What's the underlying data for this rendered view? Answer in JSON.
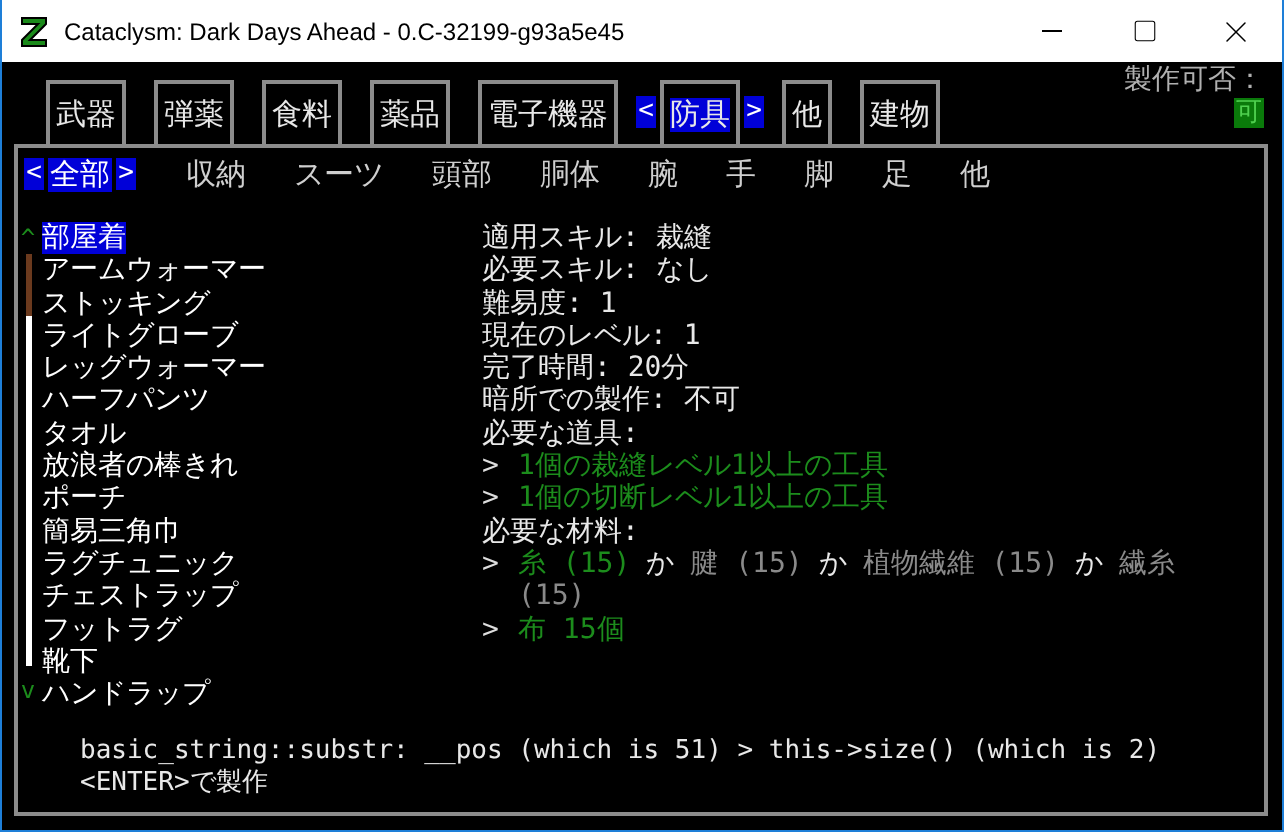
{
  "window": {
    "title": "Cataclysm: Dark Days Ahead - 0.C-32199-g93a5e45"
  },
  "tabs": [
    {
      "label": "武器",
      "selected": false
    },
    {
      "label": "弾薬",
      "selected": false
    },
    {
      "label": "食料",
      "selected": false
    },
    {
      "label": "薬品",
      "selected": false
    },
    {
      "label": "電子機器",
      "selected": false
    },
    {
      "label": "防具",
      "selected": true
    },
    {
      "label": "他",
      "selected": false
    },
    {
      "label": "建物",
      "selected": false
    }
  ],
  "craftable": {
    "label": "製作可否：",
    "value": "可"
  },
  "tab_arrows": {
    "left": "<",
    "right": ">"
  },
  "subtabs": [
    {
      "label": "全部",
      "selected": true
    },
    {
      "label": "収納",
      "selected": false
    },
    {
      "label": "スーツ",
      "selected": false
    },
    {
      "label": "頭部",
      "selected": false
    },
    {
      "label": "胴体",
      "selected": false
    },
    {
      "label": "腕",
      "selected": false
    },
    {
      "label": "手",
      "selected": false
    },
    {
      "label": "脚",
      "selected": false
    },
    {
      "label": "足",
      "selected": false
    },
    {
      "label": "他",
      "selected": false
    }
  ],
  "scrollbar": {
    "up": "^",
    "down": "v"
  },
  "recipes": [
    {
      "name": "部屋着",
      "selected": true
    },
    {
      "name": "アームウォーマー",
      "selected": false
    },
    {
      "name": "ストッキング",
      "selected": false
    },
    {
      "name": "ライトグローブ",
      "selected": false
    },
    {
      "name": "レッグウォーマー",
      "selected": false
    },
    {
      "name": "ハーフパンツ",
      "selected": false
    },
    {
      "name": "タオル",
      "selected": false
    },
    {
      "name": "放浪者の棒きれ",
      "selected": false
    },
    {
      "name": "ポーチ",
      "selected": false
    },
    {
      "name": "簡易三角巾",
      "selected": false
    },
    {
      "name": "ラグチュニック",
      "selected": false
    },
    {
      "name": "チェストラップ",
      "selected": false
    },
    {
      "name": "フットラグ",
      "selected": false
    },
    {
      "name": "靴下",
      "selected": false
    },
    {
      "name": "ハンドラップ",
      "selected": false
    }
  ],
  "details": [
    {
      "kind": "text",
      "text": "適用スキル: 裁縫"
    },
    {
      "kind": "text",
      "text": "必要スキル: なし"
    },
    {
      "kind": "text",
      "text": "難易度: 1"
    },
    {
      "kind": "text",
      "text": "現在のレベル: 1"
    },
    {
      "kind": "text",
      "text": "完了時間: 20分"
    },
    {
      "kind": "text",
      "text": "暗所での製作: 不可"
    },
    {
      "kind": "text",
      "text": "必要な道具:"
    },
    {
      "kind": "requirement",
      "marker": ">",
      "parts": [
        {
          "text": "1個の裁縫レベル1以上の工具",
          "available": true
        }
      ]
    },
    {
      "kind": "requirement",
      "marker": ">",
      "parts": [
        {
          "text": "1個の切断レベル1以上の工具",
          "available": true
        }
      ]
    },
    {
      "kind": "text",
      "text": "必要な材料:"
    },
    {
      "kind": "requirement",
      "marker": ">",
      "parts": [
        {
          "text": "糸 (15)",
          "available": true
        },
        {
          "text": "か",
          "kind": "or"
        },
        {
          "text": "腱 (15)",
          "available": false
        },
        {
          "text": "か",
          "kind": "or"
        },
        {
          "text": "植物繊維 (15)",
          "available": false
        },
        {
          "text": "か",
          "kind": "or"
        },
        {
          "text": "繊糸",
          "available": false
        }
      ]
    },
    {
      "kind": "requirement",
      "parts": [
        {
          "text": "(15)",
          "available": false
        }
      ]
    },
    {
      "kind": "requirement",
      "marker": ">",
      "parts": [
        {
          "text": "布 15個",
          "available": true
        }
      ]
    }
  ],
  "messages": [
    "basic_string::substr: __pos (which is 51) > this->size() (which is 2)",
    "<ENTER>で製作"
  ]
}
